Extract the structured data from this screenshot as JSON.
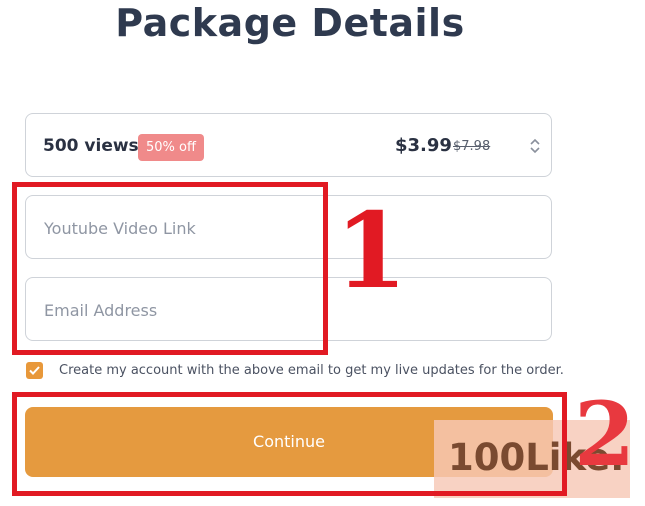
{
  "page": {
    "title": "Package Details"
  },
  "package": {
    "name": "500 views",
    "discount": "50% off",
    "price": "$3.99",
    "original_price": "$7.98"
  },
  "form": {
    "video_link_placeholder": "Youtube Video Link",
    "email_placeholder": "Email Address",
    "create_account_checked": true,
    "create_account_label": "Create my account with the above email to get my live updates for the order.",
    "continue_label": "Continue"
  },
  "annotations": {
    "step_1": "1",
    "step_2": "2",
    "color": "#e11a23"
  },
  "watermark": {
    "text": "100Like."
  },
  "colors": {
    "accent": "#e59a3f",
    "badge": "#f08a8a",
    "heading": "#2f3a4f"
  }
}
